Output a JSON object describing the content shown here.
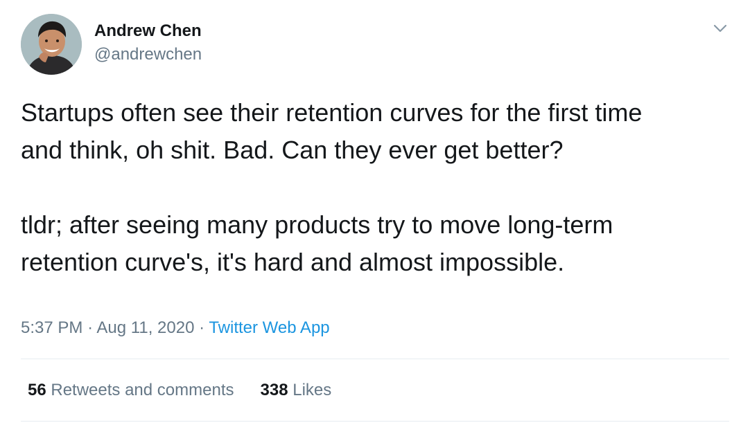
{
  "author": {
    "name": "Andrew Chen",
    "handle": "@andrewchen"
  },
  "tweet": {
    "paragraphs": [
      "Startups often see their retention curves for the first time\nand think, oh shit. Bad. Can they ever get better?",
      "tldr; after seeing many products try to move long-term\nretention curve's, it's hard and almost impossible."
    ],
    "time": "5:37 PM",
    "separator": "·",
    "date": "Aug 11, 2020",
    "source": "Twitter Web App"
  },
  "stats": {
    "retweets_count": "56",
    "retweets_label": "Retweets and comments",
    "likes_count": "338",
    "likes_label": "Likes"
  },
  "colors": {
    "text": "#14171a",
    "secondary": "#657786",
    "link": "#1b95e0",
    "divider": "#e6ecf0"
  },
  "icons": {
    "menu": "chevron-down-icon",
    "avatar": "avatar"
  }
}
